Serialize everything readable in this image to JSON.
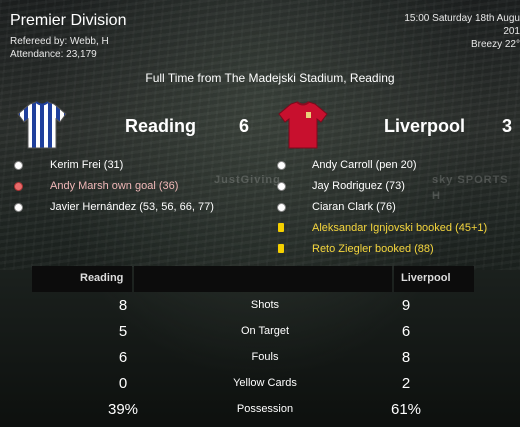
{
  "header": {
    "competition": "Premier Division",
    "referee": "Refereed by: Webb, H",
    "attendance": "Attendance: 23,179",
    "datetime": "15:00 Saturday 18th Augu",
    "year_fragment": "201",
    "weather": "Breezy 22°"
  },
  "match": {
    "result_line": "Full Time from The Madejski Stadium, Reading",
    "home": {
      "name": "Reading",
      "score": "6",
      "shirt_colors": [
        "#1f3f9c",
        "#ffffff"
      ]
    },
    "away": {
      "name": "Liverpool",
      "score": "3",
      "shirt_colors": [
        "#c8102e",
        "#a00d25"
      ]
    }
  },
  "home_events": [
    {
      "text": "Kerim Frei (31)",
      "type": "goal"
    },
    {
      "text": "Andy Marsh own goal (36)",
      "type": "own-goal"
    },
    {
      "text": "Javier Hernández (53, 56, 66, 77)",
      "type": "goal"
    }
  ],
  "away_events": [
    {
      "text": "Andy Carroll (pen 20)",
      "type": "goal"
    },
    {
      "text": "Jay Rodriguez (73)",
      "type": "goal"
    },
    {
      "text": "Ciaran Clark (76)",
      "type": "goal"
    },
    {
      "text": "Aleksandar Ignjovski booked (45+1)",
      "type": "yellow-card"
    },
    {
      "text": "Reto Ziegler booked (88)",
      "type": "yellow-card"
    }
  ],
  "stadium_boards": [
    "JustGiving",
    "sky SPORTS H"
  ],
  "stats": {
    "home_label": "Reading",
    "away_label": "Liverpool",
    "rows": [
      {
        "name": "Shots",
        "home": "8",
        "away": "9"
      },
      {
        "name": "On Target",
        "home": "5",
        "away": "6"
      },
      {
        "name": "Fouls",
        "home": "6",
        "away": "8"
      },
      {
        "name": "Yellow Cards",
        "home": "0",
        "away": "2"
      },
      {
        "name": "Possession",
        "home": "39%",
        "away": "61%"
      }
    ]
  },
  "colors": {
    "booking": "#f5d63d",
    "own_goal": "#f0b8b8",
    "stats_header_bg": "#0c0c0c"
  }
}
